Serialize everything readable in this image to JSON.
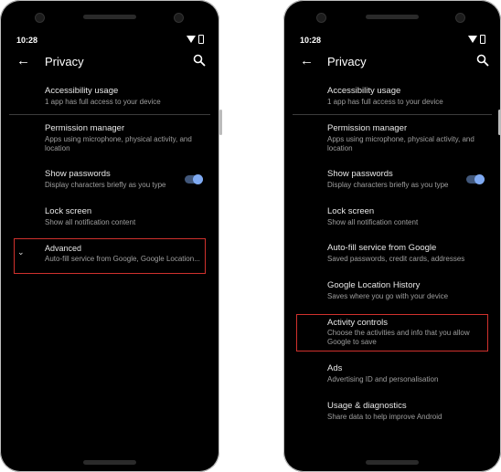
{
  "colors": {
    "screen_bg": "#000000",
    "accent": "#7faaf2",
    "highlight": "#d0312d"
  },
  "left": {
    "status_time": "10:28",
    "title": "Privacy",
    "items": [
      {
        "title": "Accessibility usage",
        "subtitle": "1 app has full access to your device"
      },
      {
        "title": "Permission manager",
        "subtitle": "Apps using microphone, physical activity, and location"
      },
      {
        "title": "Show passwords",
        "subtitle": "Display characters briefly as you type",
        "toggle": true
      },
      {
        "title": "Lock screen",
        "subtitle": "Show all notification content"
      },
      {
        "title": "Advanced",
        "subtitle": "Auto-fill service from Google, Google Location..."
      }
    ]
  },
  "right": {
    "status_time": "10:28",
    "title": "Privacy",
    "items": [
      {
        "title": "Accessibility usage",
        "subtitle": "1 app has full access to your device"
      },
      {
        "title": "Permission manager",
        "subtitle": "Apps using microphone, physical activity, and location"
      },
      {
        "title": "Show passwords",
        "subtitle": "Display characters briefly as you type",
        "toggle": true
      },
      {
        "title": "Lock screen",
        "subtitle": "Show all notification content"
      },
      {
        "title": "Auto-fill service from Google",
        "subtitle": "Saved passwords, credit cards, addresses"
      },
      {
        "title": "Google Location History",
        "subtitle": "Saves where you go with your device"
      },
      {
        "title": "Activity controls",
        "subtitle": "Choose the activities and info that you allow Google to save"
      },
      {
        "title": "Ads",
        "subtitle": "Advertising ID and personalisation"
      },
      {
        "title": "Usage & diagnostics",
        "subtitle": "Share data to help improve Android"
      }
    ]
  }
}
